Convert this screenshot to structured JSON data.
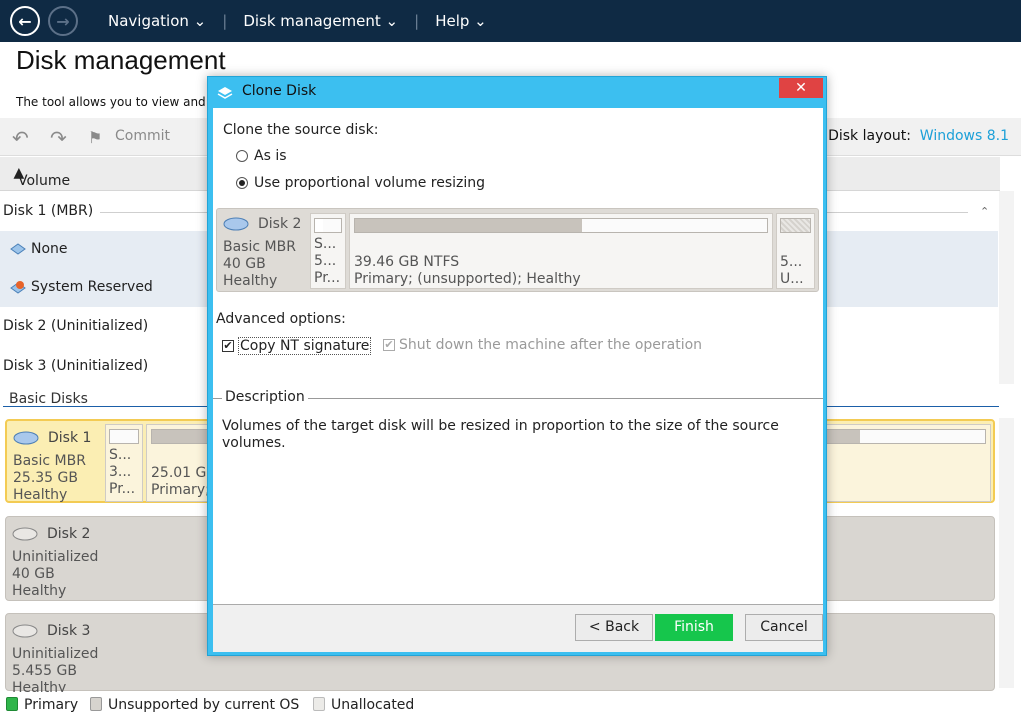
{
  "nav": {
    "back_icon": "back-arrow-icon",
    "forward_icon": "forward-arrow-icon",
    "menu": [
      "Navigation",
      "Disk management",
      "Help"
    ]
  },
  "page": {
    "title": "Disk management",
    "subtitle": "The tool allows you to view and ma"
  },
  "toolbar": {
    "commit": "Commit",
    "layout_label": "Disk layout:",
    "layout_value": "Windows 8.1"
  },
  "volumes": {
    "header": "Volume",
    "rows": [
      "Disk 1 (MBR)",
      "None",
      "System Reserved",
      "Disk 2 (Uninitialized)",
      "Disk 3 (Uninitialized)"
    ]
  },
  "basic_disks": {
    "label": "Basic Disks",
    "disk1": {
      "name": "Disk 1",
      "type": "Basic MBR",
      "size": "25.35 GB",
      "status": "Healthy",
      "p1a": "S...",
      "p1b": "3...",
      "p1c": "Pr...",
      "p2a": "25.01 G",
      "p2b": "Primary;"
    },
    "disk2": {
      "name": "Disk 2",
      "type": "Uninitialized",
      "size": "40 GB",
      "status": "Healthy"
    },
    "disk3": {
      "name": "Disk 3",
      "type": "Uninitialized",
      "size": "5.455 GB",
      "status": "Healthy"
    }
  },
  "legend": [
    "Primary",
    "Unsupported by current OS",
    "Unallocated"
  ],
  "dialog": {
    "title": "Clone Disk",
    "close": "✕",
    "clone_label": "Clone the source disk:",
    "option_as_is": "As is",
    "option_proportional": "Use proportional volume resizing",
    "selected_option": "proportional",
    "disk": {
      "name": "Disk 2",
      "type": "Basic MBR",
      "size": "40 GB",
      "status": "Healthy",
      "p1_line1": "S...",
      "p1_line2": "5...",
      "p1_line3": "Pr...",
      "p2_line1": "39.46 GB NTFS",
      "p2_line2": "Primary;  (unsupported); Healthy",
      "p2_fill": 0.55,
      "p3_line1": "5...",
      "p3_line2": "U..."
    },
    "advanced_label": "Advanced options:",
    "copy_nt": "Copy NT signature",
    "shutdown": "Shut down the machine after the operation",
    "description_title": "Description",
    "description_text": "Volumes of the target disk will be resized in proportion to the size of the source volumes.",
    "buttons": {
      "back": "< Back",
      "finish": "Finish",
      "cancel": "Cancel"
    }
  }
}
